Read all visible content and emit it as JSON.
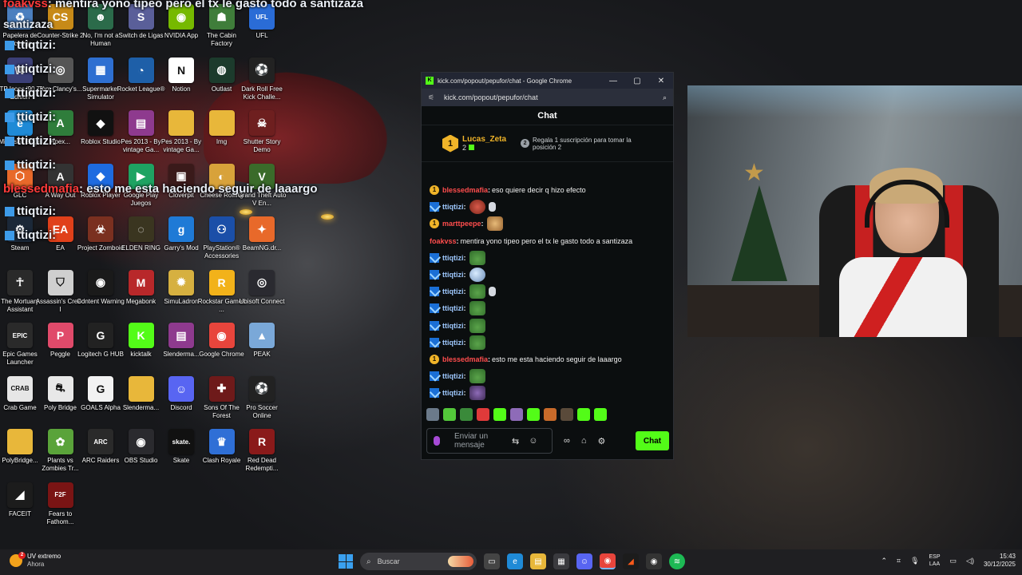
{
  "desktop": {
    "icons": [
      {
        "label": "Papelera de reciclaje",
        "icon": "recycle-bin-icon",
        "color": "#4b7fbf",
        "glyph": "♻"
      },
      {
        "label": "Counter-Strike 2",
        "icon": "cs2-icon",
        "color": "#c78a18",
        "glyph": "CS"
      },
      {
        "label": "No, I'm not a Human",
        "icon": "not-human-icon",
        "color": "#2b6b4a",
        "glyph": "☻"
      },
      {
        "label": "Switch de Ligas",
        "icon": "switch-ligas-icon",
        "color": "#5a5f99",
        "glyph": "S"
      },
      {
        "label": "NVIDIA App",
        "icon": "nvidia-icon",
        "color": "#76b900",
        "glyph": "◉"
      },
      {
        "label": "The Cabin Factory",
        "icon": "cabin-factory-icon",
        "color": "#3f7d3a",
        "glyph": "☗"
      },
      {
        "label": "UFL",
        "icon": "ufl-icon",
        "color": "#2a6cd6",
        "glyph": "UFL"
      },
      {
        "label": "PTP Icons '90 TK Edition",
        "icon": "ptp-icon",
        "color": "#3b3f76",
        "glyph": "W"
      },
      {
        "label": "Tom Clancy's...",
        "icon": "tom-clancy-icon",
        "color": "#555",
        "glyph": "◎"
      },
      {
        "label": "Supermarket Simulator",
        "icon": "supermarket-icon",
        "color": "#2e6fd1",
        "glyph": "▦"
      },
      {
        "label": "Rocket League®",
        "icon": "rocket-league-icon",
        "color": "#1e5fa8",
        "glyph": "◔"
      },
      {
        "label": "Notion",
        "icon": "notion-icon",
        "color": "#ffffff",
        "glyph": "N"
      },
      {
        "label": "Outlast",
        "icon": "outlast-icon",
        "color": "#1c3b2c",
        "glyph": "◍"
      },
      {
        "label": "Dark Roll Free Kick Challe...",
        "icon": "soccer-ball-icon",
        "color": "#222",
        "glyph": "⚽"
      },
      {
        "label": "Microsoft Edge",
        "icon": "edge-icon",
        "color": "#1f8ad6",
        "glyph": "e"
      },
      {
        "label": "Apex...",
        "icon": "apex-icon",
        "color": "#2f7d3b",
        "glyph": "A"
      },
      {
        "label": "Roblox Studio",
        "icon": "roblox-studio-icon",
        "color": "#111",
        "glyph": "◆"
      },
      {
        "label": "Pes 2013 - By vintage Ga...",
        "icon": "winrar-icon",
        "color": "#8e3a8e",
        "glyph": "▤"
      },
      {
        "label": "Pes 2013 - By vintage Ga...",
        "icon": "folder-icon",
        "color": "#e8b73a",
        "glyph": ""
      },
      {
        "label": "Img",
        "icon": "folder-icon",
        "color": "#e8b73a",
        "glyph": ""
      },
      {
        "label": "Shutter Story Demo",
        "icon": "shutter-story-icon",
        "color": "#6e1f1f",
        "glyph": "☠"
      },
      {
        "label": "GLC",
        "icon": "glc-icon",
        "color": "#e8692a",
        "glyph": "⬡"
      },
      {
        "label": "A Way Out",
        "icon": "a-way-out-icon",
        "color": "#333",
        "glyph": "A"
      },
      {
        "label": "Roblox Player",
        "icon": "roblox-icon",
        "color": "#1e6be0",
        "glyph": "◆"
      },
      {
        "label": "Google Play Juegos",
        "icon": "google-play-icon",
        "color": "#1ea362",
        "glyph": "▶"
      },
      {
        "label": "Cloverpit",
        "icon": "cloverpit-icon",
        "color": "#3a1a1a",
        "glyph": "▣"
      },
      {
        "label": "Cheese Rolling",
        "icon": "cheese-rolling-icon",
        "color": "#d8a23a",
        "glyph": "◐"
      },
      {
        "label": "Grand Theft Auto V En...",
        "icon": "gta-icon",
        "color": "#3a6b2a",
        "glyph": "V"
      },
      {
        "label": "Steam",
        "icon": "steam-icon",
        "color": "#1b2838",
        "glyph": "⚙"
      },
      {
        "label": "EA",
        "icon": "ea-icon",
        "color": "#e0401a",
        "glyph": "EA"
      },
      {
        "label": "Project Zomboid",
        "icon": "project-zomboid-icon",
        "color": "#7a3020",
        "glyph": "☣"
      },
      {
        "label": "ELDEN RING",
        "icon": "elden-ring-icon",
        "color": "#3a3520",
        "glyph": "◌"
      },
      {
        "label": "Garry's Mod",
        "icon": "garrys-mod-icon",
        "color": "#1f7ad6",
        "glyph": "g"
      },
      {
        "label": "PlayStation® Accessories",
        "icon": "playstation-icon",
        "color": "#1b4fa8",
        "glyph": "⚇"
      },
      {
        "label": "BeamNG.dr...",
        "icon": "beamng-icon",
        "color": "#e8692a",
        "glyph": "✦"
      },
      {
        "label": "The Mortuary Assistant",
        "icon": "mortuary-icon",
        "color": "#2a2a2a",
        "glyph": "☥"
      },
      {
        "label": "Assassin's Creed I",
        "icon": "assassins-creed-icon",
        "color": "#cfcfcf",
        "glyph": "⛉"
      },
      {
        "label": "Content Warning",
        "icon": "content-warning-icon",
        "color": "#1a1a1a",
        "glyph": "◉"
      },
      {
        "label": "Megabonk",
        "icon": "megabonk-icon",
        "color": "#b8282a",
        "glyph": "M"
      },
      {
        "label": "SimuLadron",
        "icon": "simuladron-icon",
        "color": "#d6b040",
        "glyph": "✹"
      },
      {
        "label": "Rockstar Games ...",
        "icon": "rockstar-icon",
        "color": "#f2b21a",
        "glyph": "R"
      },
      {
        "label": "Ubisoft Connect",
        "icon": "ubisoft-icon",
        "color": "#2a2a30",
        "glyph": "◎"
      },
      {
        "label": "Epic Games Launcher",
        "icon": "epic-games-icon",
        "color": "#2a2a2a",
        "glyph": "EPIC"
      },
      {
        "label": "Peggle",
        "icon": "peggle-icon",
        "color": "#e04a6a",
        "glyph": "P"
      },
      {
        "label": "Logitech G HUB",
        "icon": "logitech-icon",
        "color": "#222",
        "glyph": "G"
      },
      {
        "label": "kicktalk",
        "icon": "kicktalk-icon",
        "color": "#53fc18",
        "glyph": "K"
      },
      {
        "label": "Slenderma...",
        "icon": "winrar-icon",
        "color": "#8e3a8e",
        "glyph": "▤"
      },
      {
        "label": "Google Chrome",
        "icon": "chrome-icon",
        "color": "#e8453c",
        "glyph": "◉"
      },
      {
        "label": "PEAK",
        "icon": "peak-icon",
        "color": "#7aa8d8",
        "glyph": "▲"
      },
      {
        "label": "Crab Game",
        "icon": "crab-game-icon",
        "color": "#e6e6e6",
        "glyph": "CRAB"
      },
      {
        "label": "Poly Bridge",
        "icon": "poly-bridge-icon",
        "color": "#e8e8e8",
        "glyph": "⛐"
      },
      {
        "label": "GOALS Alpha",
        "icon": "goals-icon",
        "color": "#f2f2f2",
        "glyph": "G"
      },
      {
        "label": "Slenderma...",
        "icon": "folder-icon",
        "color": "#e8b73a",
        "glyph": ""
      },
      {
        "label": "Discord",
        "icon": "discord-icon",
        "color": "#5865f2",
        "glyph": "☺"
      },
      {
        "label": "Sons Of The Forest",
        "icon": "sons-forest-icon",
        "color": "#6e1a1a",
        "glyph": "✚"
      },
      {
        "label": "Pro Soccer Online",
        "icon": "pro-soccer-icon",
        "color": "#222",
        "glyph": "⚽"
      },
      {
        "label": "PolyBridge...",
        "icon": "folder-icon",
        "color": "#e8b73a",
        "glyph": ""
      },
      {
        "label": "Plants vs Zombies Tr...",
        "icon": "pvz-icon",
        "color": "#5aa33a",
        "glyph": "✿"
      },
      {
        "label": "ARC Raiders",
        "icon": "arc-raiders-icon",
        "color": "#2a2a2a",
        "glyph": "ARC"
      },
      {
        "label": "OBS Studio",
        "icon": "obs-icon",
        "color": "#2a2a2e",
        "glyph": "◉"
      },
      {
        "label": "Skate",
        "icon": "skate-icon",
        "color": "#111",
        "glyph": "skate."
      },
      {
        "label": "Clash Royale",
        "icon": "clash-royale-icon",
        "color": "#2f6fd6",
        "glyph": "♛"
      },
      {
        "label": "Red Dead Redempti...",
        "icon": "rdr-icon",
        "color": "#8a1a1a",
        "glyph": "R"
      },
      {
        "label": "FACEIT",
        "icon": "faceit-icon",
        "color": "#1c1c1c",
        "glyph": "◢"
      },
      {
        "label": "Fears to Fathom...",
        "icon": "f2f-icon",
        "color": "#7a1414",
        "glyph": "F2F"
      }
    ]
  },
  "overlay_chat": [
    {
      "user": "foakvss",
      "text": "mentira yono tipeo pero el tx le gasto todo a santizaza"
    },
    {
      "user": "ttiqtizi:",
      "text": ""
    },
    {
      "user": "ttiqtizi:",
      "text": ""
    },
    {
      "user": "ttiqtizi:",
      "text": ""
    },
    {
      "user": "ttiqtizi:",
      "text": ""
    },
    {
      "user": "ttiqtizi:",
      "text": ""
    },
    {
      "user": "blessedmafia",
      "text": "esto me esta haciendo seguir de laaargo"
    },
    {
      "user": "ttiqtizi:",
      "text": ""
    },
    {
      "user": "ttiqtizi:",
      "text": ""
    }
  ],
  "browser": {
    "title": "kick.com/popout/pepufor/chat - Google Chrome",
    "url": "kick.com/popout/pepufor/chat",
    "favicon": "K"
  },
  "chat": {
    "header": "Chat",
    "top_gifter": {
      "name": "Lucas_Zeta",
      "count": "2",
      "rank": "1"
    },
    "gift_prompt": {
      "rank": "2",
      "text": "Regala 1 suscripción para tomar la posición 2"
    },
    "messages": [
      {
        "badge": "sub",
        "user": "blessedmafia",
        "user_color": "red",
        "text": "eso quiere decir q hizo efecto",
        "emotes": []
      },
      {
        "badge": "prime",
        "user": "ttiqtizi",
        "user_color": "blue",
        "text": "",
        "emotes": [
          "red",
          "small"
        ]
      },
      {
        "badge": "sub",
        "user": "marttpeepe",
        "user_color": "red",
        "text": "",
        "emotes": [
          "wolf"
        ]
      },
      {
        "badge": "none",
        "user": "foakvss",
        "user_color": "red",
        "text": "mentira yono tipeo pero el tx le gasto todo a santizaza",
        "emotes": []
      },
      {
        "badge": "prime",
        "user": "ttiqtizi",
        "user_color": "blue",
        "text": "",
        "emotes": [
          "frog"
        ]
      },
      {
        "badge": "prime",
        "user": "ttiqtizi",
        "user_color": "blue",
        "text": "",
        "emotes": [
          "globe"
        ]
      },
      {
        "badge": "prime",
        "user": "ttiqtizi",
        "user_color": "blue",
        "text": "",
        "emotes": [
          "frog",
          "small"
        ]
      },
      {
        "badge": "prime",
        "user": "ttiqtizi",
        "user_color": "blue",
        "text": "",
        "emotes": [
          "frog"
        ]
      },
      {
        "badge": "prime",
        "user": "ttiqtizi",
        "user_color": "blue",
        "text": "",
        "emotes": [
          "frog"
        ]
      },
      {
        "badge": "prime",
        "user": "ttiqtizi",
        "user_color": "blue",
        "text": "",
        "emotes": [
          "frog"
        ]
      },
      {
        "badge": "sub",
        "user": "blessedmafia",
        "user_color": "red",
        "text": "esto me esta haciendo seguir de laaargo",
        "emotes": []
      },
      {
        "badge": "prime",
        "user": "ttiqtizi",
        "user_color": "blue",
        "text": "",
        "emotes": [
          "frog"
        ]
      },
      {
        "badge": "prime",
        "user": "ttiqtizi",
        "user_color": "blue",
        "text": "",
        "emotes": [
          "purple"
        ]
      }
    ],
    "input_placeholder": "Enviar un mensaje",
    "send_label": "Chat"
  },
  "taskbar": {
    "weather": {
      "temp_badge": "2",
      "line1": "UV extremo",
      "line2": "Ahora"
    },
    "search_placeholder": "Buscar",
    "language": {
      "line1": "ESP",
      "line2": "LAA"
    },
    "clock": {
      "time": "15:43",
      "date": "30/12/2025"
    }
  },
  "colors": {
    "kick_green": "#53fc18",
    "sub_gold": "#f0b429",
    "username_red": "#ff4d4d"
  }
}
